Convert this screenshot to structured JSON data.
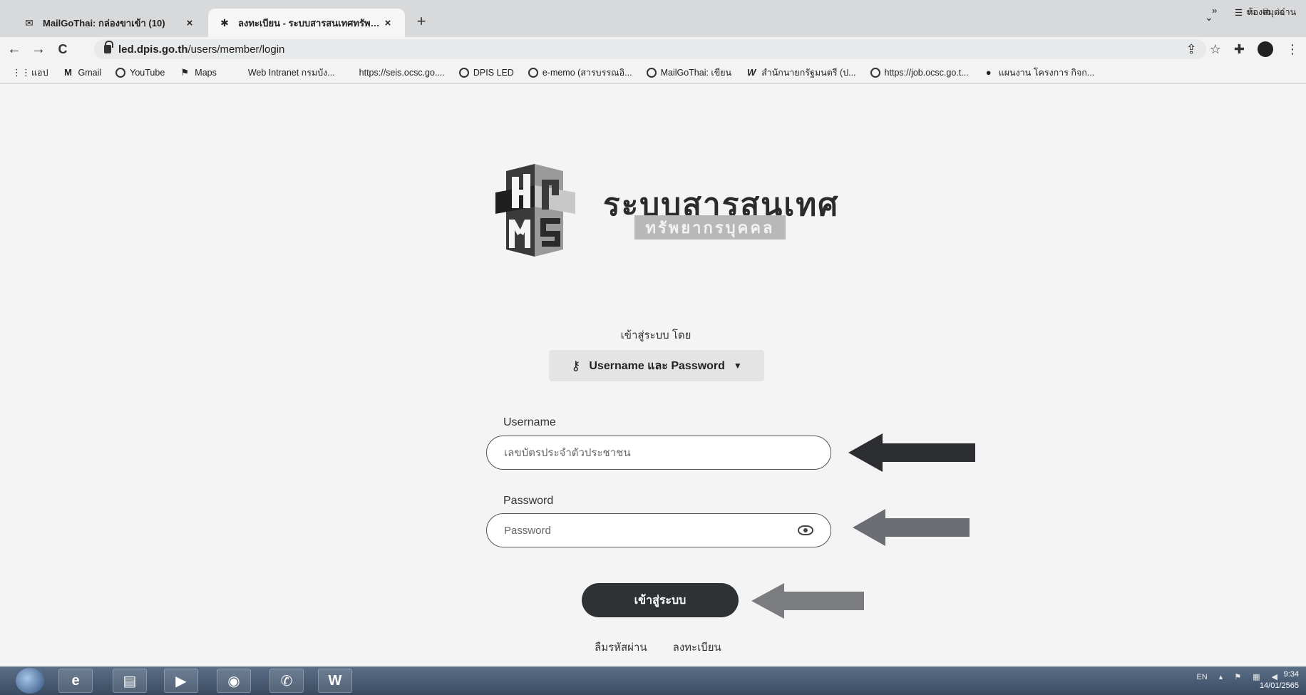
{
  "tabs": [
    {
      "label": "MailGoThai: กล่องขาเข้า (10)",
      "close": "×",
      "favicon": "mail-icon"
    },
    {
      "label": "ลงทะเบียน - ระบบสารสนเทศทรัพยากร",
      "close": "×",
      "favicon": "hrms-icon"
    }
  ],
  "new_tab": "+",
  "toolbar": {
    "back": "←",
    "forward": "→",
    "reload": "C",
    "url_host": "led.dpis.go.th",
    "url_path": "/users/member/login"
  },
  "bookmarks": [
    {
      "label": "แอป",
      "icon": "apps-icon"
    },
    {
      "label": "Gmail",
      "icon": "gmail-icon"
    },
    {
      "label": "YouTube",
      "icon": "globe-icon"
    },
    {
      "label": "Maps",
      "icon": "maps-icon"
    },
    {
      "label": "Web Intranet กรมบัง...",
      "icon": ""
    },
    {
      "label": "https://seis.ocsc.go....",
      "icon": ""
    },
    {
      "label": "DPIS LED",
      "icon": "globe-icon"
    },
    {
      "label": "e-memo (สารบรรณอิ...",
      "icon": "globe-icon"
    },
    {
      "label": "MailGoThai: เขียน",
      "icon": "globe-icon"
    },
    {
      "label": "สำนักนายกรัฐมนตรี (ป...",
      "icon": "wiki-icon"
    },
    {
      "label": "https://job.ocsc.go.t...",
      "icon": "globe-icon"
    },
    {
      "label": "แผนงาน โครงการ กิจก...",
      "icon": "dot-icon"
    }
  ],
  "bookmarks_more": "»",
  "reading_list": "ห้องสมุดอ่าน",
  "brand": {
    "title": "ระบบสารสนเทศ",
    "subtitle": "ทรัพยากรบุคคล"
  },
  "login": {
    "signin_by": "เข้าสู่ระบบ โดย",
    "method": "Username และ Password",
    "username_label": "Username",
    "username_placeholder": "เลขบัตรประจำตัวประชาชน",
    "password_label": "Password",
    "password_placeholder": "Password",
    "submit": "เข้าสู่ระบบ",
    "forgot": "ลืมรหัสผ่าน",
    "register": "ลงทะเบียน"
  },
  "taskbar": {
    "lang": "EN",
    "time": "9:34",
    "date": "14/01/2565"
  }
}
